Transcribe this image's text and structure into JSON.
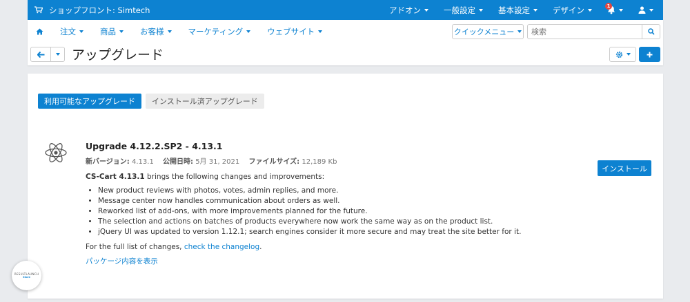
{
  "topbar": {
    "store_name": "ショップフロント: Simtech",
    "nav": [
      "アドオン",
      "一般設定",
      "基本設定",
      "デザイン"
    ],
    "notifications_count": "1",
    "icons": [
      "cart-icon",
      "bell-icon",
      "user-icon"
    ]
  },
  "subnav": {
    "items": [
      "注文",
      "商品",
      "お客様",
      "マーケティング",
      "ウェブサイト"
    ],
    "quick_menu": "クイックメニュー",
    "search_placeholder": "検索"
  },
  "page": {
    "title": "アップグレード"
  },
  "tabs": {
    "available": "利用可能なアップグレード",
    "installed": "インストール済アップグレード"
  },
  "upgrade": {
    "title": "Upgrade 4.12.2.SP2 - 4.13.1",
    "version_label": "新バージョン:",
    "version_value": "4.13.1",
    "date_label": "公開日時:",
    "date_value": "5月 31, 2021",
    "size_label": "ファイルサイズ:",
    "size_value": "12,189 Kb",
    "intro_product": "CS-Cart 4.13.1",
    "intro_text": " brings the following changes and improvements:",
    "changes": [
      "New product reviews with photos, votes, admin replies, and more.",
      "Message center now handles communication about orders as well.",
      "Reworked list of add-ons, with more improvements planned for the future.",
      "The selection and actions on batches of products everywhere now work the same way as on the product list.",
      "jQuery UI was updated to version 1.12.1; search engines consider it more secure and may treat the site better for it."
    ],
    "full_list_text": "For the full list of changes, ",
    "changelog_link": "check the changelog",
    "full_list_end": ".",
    "package_link": "パッケージ内容を表示",
    "install_button": "インストール"
  },
  "float_logo": {
    "line1": "RESULTLAUNCH",
    "line2": "Store"
  },
  "colors": {
    "primary": "#0d82d1",
    "background": "#e9ebee",
    "badge": "#e8473f"
  }
}
